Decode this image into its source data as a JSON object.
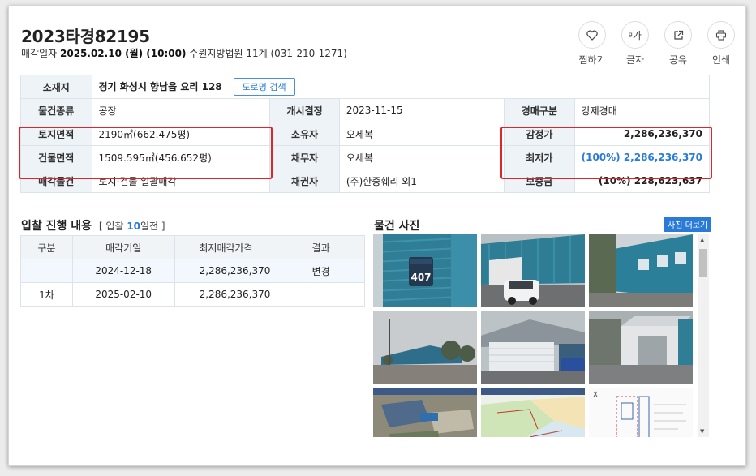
{
  "header": {
    "case_no": "2023타경82195",
    "sale_date_label": "매각일자",
    "sale_date": "2025.02.10 (월) (10:00)",
    "court": "수원지방법원 11계 (031-210-1271)"
  },
  "actions": [
    {
      "label": "찜하기",
      "icon": "heart-icon"
    },
    {
      "label": "글자",
      "icon": "font-size-icon",
      "glyph": "ᵍ가"
    },
    {
      "label": "공유",
      "icon": "share-icon"
    },
    {
      "label": "인쇄",
      "icon": "print-icon"
    }
  ],
  "info": {
    "location_label": "소재지",
    "location": "경기 화성시 향남읍 요리 128",
    "road_btn": "도로명 검색",
    "kind_label": "물건종류",
    "kind": "공장",
    "start_label": "개시결정",
    "start": "2023-11-15",
    "type_label": "경매구분",
    "type": "강제경매",
    "land_label": "토지면적",
    "land": "2190㎡(662.475평)",
    "owner_label": "소유자",
    "owner": "오세복",
    "appraisal_label": "감정가",
    "appraisal": "2,286,236,370",
    "building_label": "건물면적",
    "building": "1509.595㎡(456.652평)",
    "debtor_label": "채무자",
    "debtor": "오세복",
    "min_label": "최저가",
    "min": "(100%) 2,286,236,370",
    "sale_obj_label": "매각물건",
    "sale_obj": "토지·건물 일괄매각",
    "creditor_label": "채권자",
    "creditor": "(주)한중훼리 외1",
    "deposit_label": "보증금",
    "deposit": "(10%) 228,623,637"
  },
  "bids": {
    "title": "입찰 진행 내용",
    "sub_prefix": "[ 입찰",
    "days": "10",
    "sub_suffix": "일전 ]",
    "columns": [
      "구분",
      "매각기일",
      "최저매각가격",
      "결과"
    ],
    "rows": [
      {
        "round": "",
        "date": "2024-12-18",
        "price": "2,286,236,370",
        "result": "변경"
      },
      {
        "round": "1차",
        "date": "2025-02-10",
        "price": "2,286,236,370",
        "result": ""
      }
    ]
  },
  "photos": {
    "title": "물건 사진",
    "more": "사진 더보기",
    "sign_text": "407"
  }
}
